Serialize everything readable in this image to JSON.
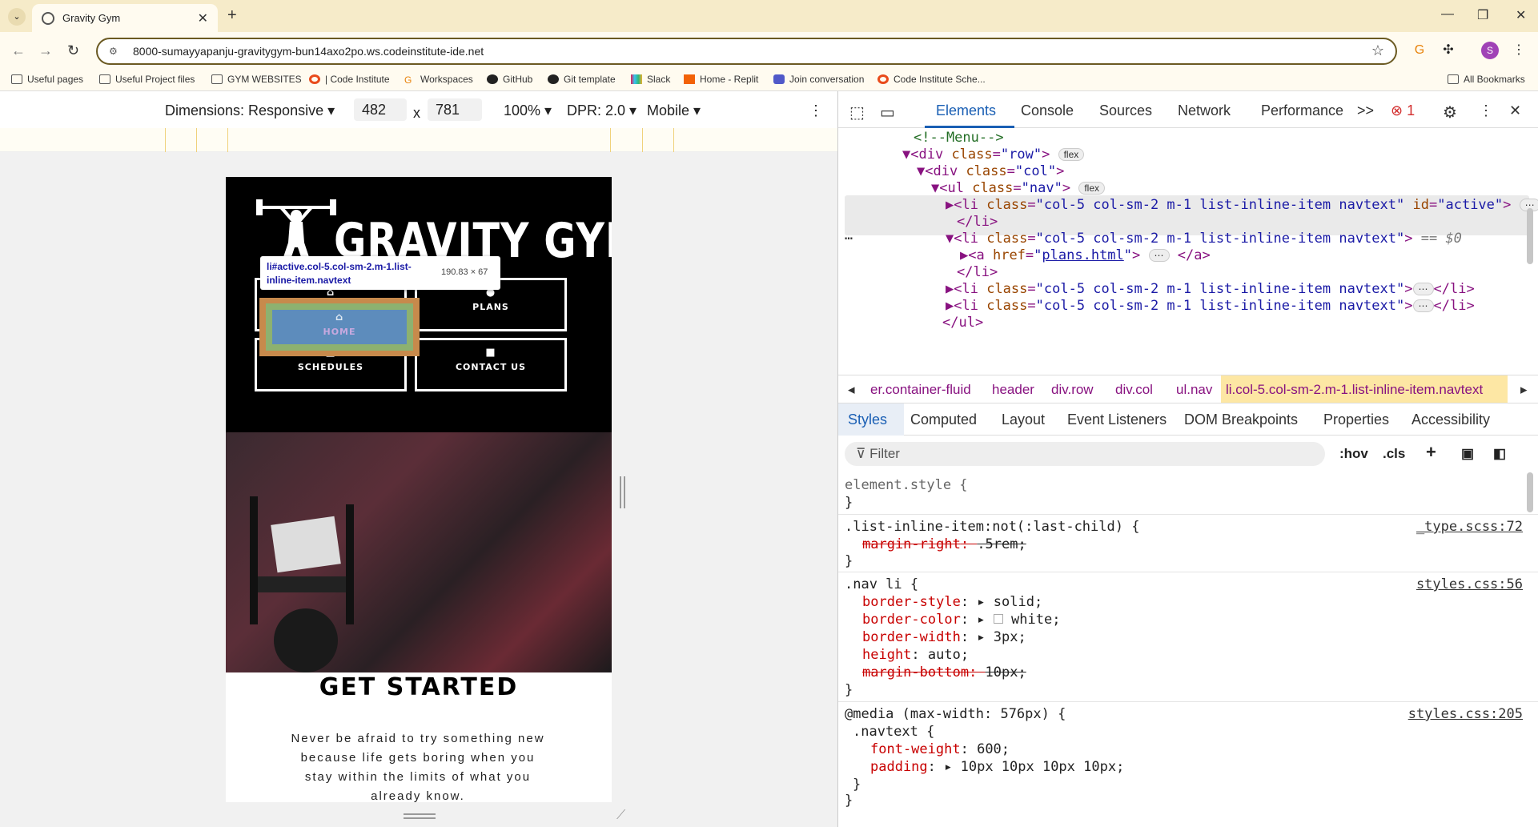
{
  "browser": {
    "tab_title": "Gravity Gym",
    "url": "8000-sumayyapanju-gravitygym-bun14axo2po.ws.codeinstitute-ide.net",
    "bookmarks": [
      "Useful pages",
      "Useful Project files",
      "GYM WEBSITES",
      "| Code Institute",
      "Workspaces",
      "GitHub",
      "Git template",
      "Slack",
      "Home - Replit",
      "Join conversation",
      "Code Institute Sche..."
    ],
    "all_bookmarks": "All Bookmarks",
    "profile_initial": "S"
  },
  "device_toolbar": {
    "dimensions": "Dimensions: Responsive",
    "width": "482",
    "times": "x",
    "height": "781",
    "zoom": "100%",
    "dpr": "DPR: 2.0",
    "throttle": "Mobile"
  },
  "site": {
    "brand": "GRAVITY GYM",
    "nav": [
      {
        "label": "HOME",
        "icon": "house-icon"
      },
      {
        "label": "PLANS",
        "icon": "person-icon"
      },
      {
        "label": "SCHEDULES",
        "icon": "calendar-icon"
      },
      {
        "label": "CONTACT US",
        "icon": "chat-icon"
      }
    ],
    "heading": "GET STARTED",
    "paragraph": "Never be afraid to try something new because life gets boring when you stay within the limits of what you already know."
  },
  "tooltip": {
    "selector": "li#active.col-5.col-sm-2.m-1.list-inline-item.navtext",
    "size": "190.83 × 67"
  },
  "devtools": {
    "tabs": [
      "Elements",
      "Console",
      "Sources",
      "Network",
      "Performance"
    ],
    "more": ">>",
    "error_count": "1",
    "dom": {
      "comment": "<!--Menu-->",
      "row": "row",
      "col": "col",
      "nav": "nav",
      "li_class": "col-5 col-sm-2 m-1 list-inline-item navtext",
      "id": "active",
      "href": "plans.html",
      "badge_flex": "flex",
      "dollar": "== $0"
    },
    "breadcrumbs": [
      "er.container-fluid",
      "header",
      "div.row",
      "div.col",
      "ul.nav",
      "li.col-5.col-sm-2.m-1.list-inline-item.navtext"
    ],
    "style_tabs": [
      "Styles",
      "Computed",
      "Layout",
      "Event Listeners",
      "DOM Breakpoints",
      "Properties",
      "Accessibility"
    ],
    "filter_placeholder": "Filter",
    "hov": ":hov",
    "cls": ".cls",
    "rules": {
      "element_style": "element.style {",
      "r1_selector": ".list-inline-item:not(:last-child) {",
      "r1_src": "_type.scss:72",
      "r1_prop": "margin-right",
      "r1_val": ".5rem;",
      "r2_selector": ".nav li {",
      "r2_src": "styles.css:56",
      "r2_props": [
        {
          "p": "border-style",
          "v": "solid;"
        },
        {
          "p": "border-color",
          "v": "white;"
        },
        {
          "p": "border-width",
          "v": "3px;"
        },
        {
          "p": "height",
          "v": "auto;"
        },
        {
          "p": "margin-bottom",
          "v": "10px;"
        }
      ],
      "r3_media": "@media (max-width: 576px) {",
      "r3_src": "styles.css:205",
      "r3_selector": ".navtext {",
      "r3_props": [
        {
          "p": "font-weight",
          "v": "600;"
        },
        {
          "p": "padding",
          "v": "10px 10px 10px 10px;"
        }
      ]
    }
  }
}
